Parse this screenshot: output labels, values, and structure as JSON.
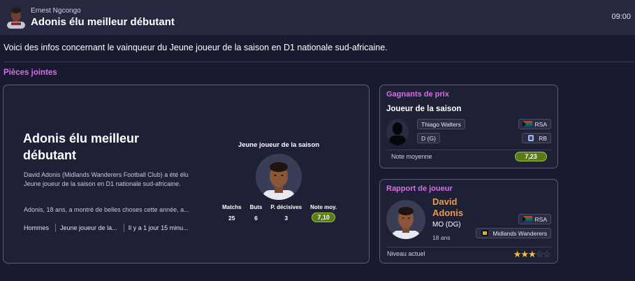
{
  "header": {
    "sender": "Ernest Ngcongo",
    "subject": "Adonis élu meilleur débutant",
    "time": "09:00"
  },
  "message": {
    "body": "Voici des infos concernant le vainqueur du Jeune joueur de la saison en D1 nationale sud-africaine.",
    "attachments_title": "Pièces jointes"
  },
  "news": {
    "headline": "Adonis élu meilleur débutant",
    "paragraph1": "David Adonis (Midlands Wanderers Football Club) a été élu Jeune joueur de la saison en D1 nationale sud-africaine.",
    "paragraph2": "Adonis, 18 ans, a montré de belles choses cette année, a...",
    "tags": [
      "Hommes",
      "Jeune joueur de la...",
      "Il y a 1 jour 15 minu..."
    ],
    "award_label": "Jeune joueur de la saison",
    "stats": [
      {
        "label": "Matchs",
        "value": "25"
      },
      {
        "label": "Buts",
        "value": "6"
      },
      {
        "label": "P. décisives",
        "value": "3"
      },
      {
        "label": "Note moy.",
        "value": "7,10"
      }
    ]
  },
  "prize": {
    "title": "Gagnants de prix",
    "award": "Joueur de la saison",
    "player_name": "Thiago Walters",
    "position": "D (G)",
    "nation": "RSA",
    "club_abbr": "RB",
    "rating_label": "Note moyenne",
    "rating_value": "7,23"
  },
  "report": {
    "title": "Rapport de joueur",
    "player_name": "David Adonis",
    "position": "MO (DG)",
    "age": "18 ans",
    "nation": "RSA",
    "club": "Midlands Wanderers",
    "level_label": "Niveau actuel",
    "stars": 3,
    "stars_max": 5
  },
  "colors": {
    "accent_title": "#d86ee6",
    "player_name": "#e89a5a",
    "rating_fill": "#5b7a1a",
    "star": "#f0c040"
  }
}
